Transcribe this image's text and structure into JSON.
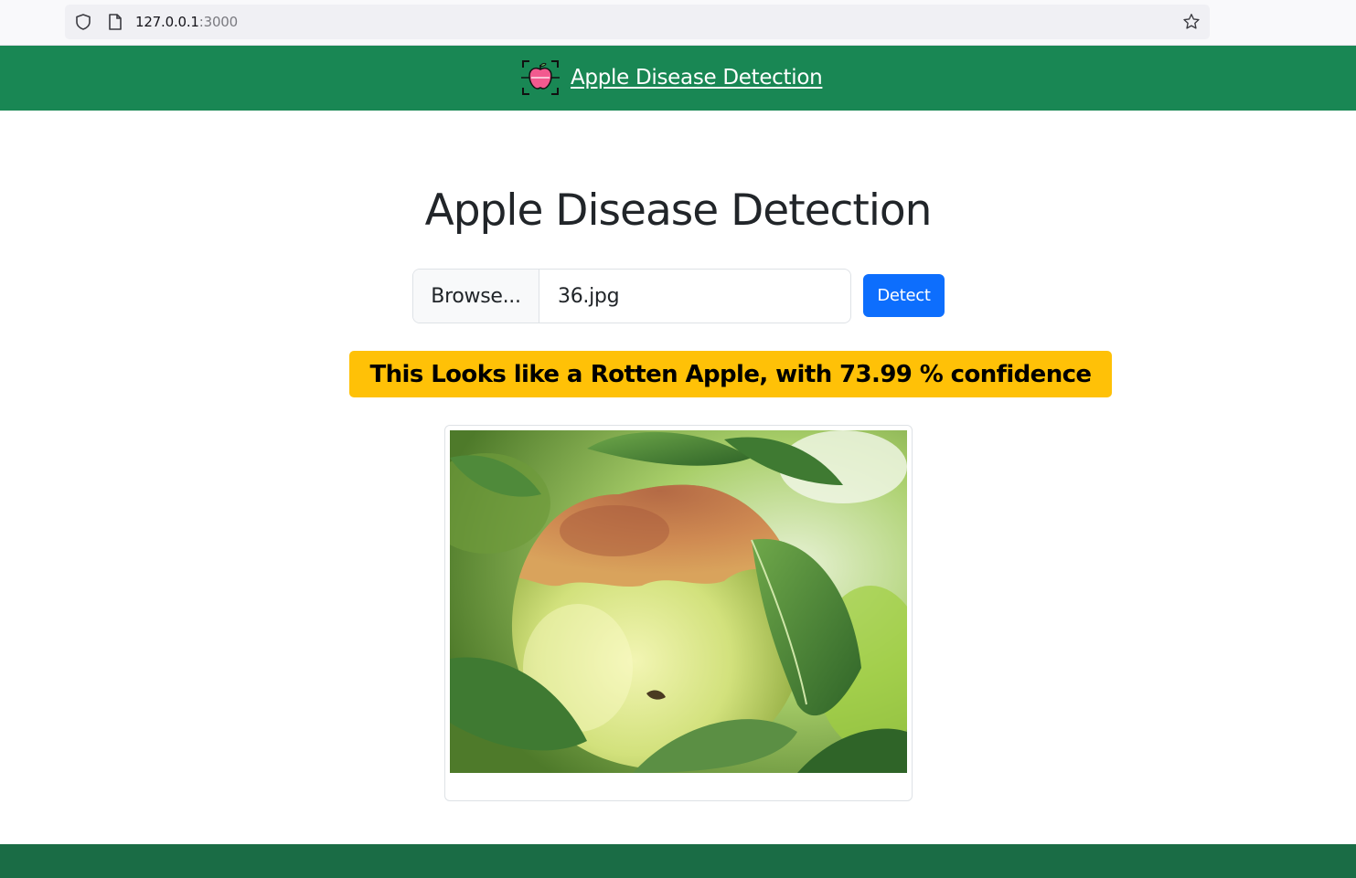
{
  "browser": {
    "url_host": "127.0.0.1",
    "url_port": ":3000",
    "icons": [
      "shield-icon",
      "page-icon",
      "star-icon"
    ]
  },
  "navbar": {
    "brand_text": "Apple Disease Detection",
    "brand_icon": "apple-scan-icon",
    "background": "#198754"
  },
  "main": {
    "title": "Apple Disease Detection",
    "file_input": {
      "browse_label": "Browse...",
      "file_name": "36.jpg"
    },
    "detect_label": "Detect",
    "result": {
      "prefix": "This Looks like a",
      "label": "Rotten Apple",
      "suffix": ", with 73.99 % confidence",
      "background": "#ffc107"
    },
    "preview_image": "rotten-apple-photo"
  },
  "footer": {
    "background": "#1a6c45"
  }
}
